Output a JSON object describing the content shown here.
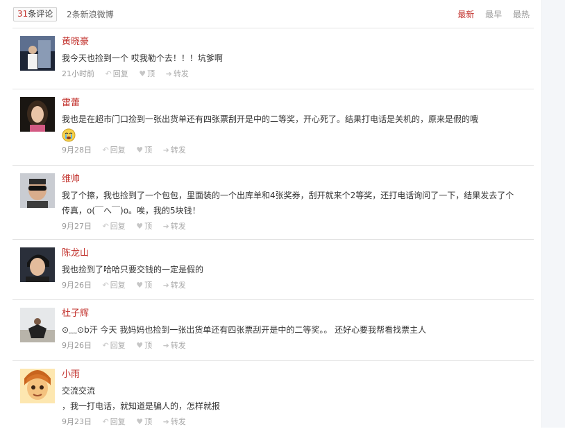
{
  "header": {
    "count_num": "31",
    "count_label": "条评论",
    "new_weibo": "2条新浪微博",
    "sort": [
      "最新",
      "最早",
      "最热"
    ]
  },
  "comments": [
    {
      "user": "黄晓豪",
      "text": "我今天也捡到一个 哎我勒个去！！！坑爹啊",
      "time": "21小时前"
    },
    {
      "user": "雷蕾",
      "text": "我也是在超市门口捡到一张出货单还有四张票刮开是中的二等奖，开心死了。结果打电话是关机的，原来是假的哦",
      "time": "9月28日"
    },
    {
      "user": "维帅",
      "text": "我了个擦，我也捡到了一个包包，里面装的一个出库单和4张奖券，刮开就来个2等奖，还打电话询问了一下，结果发去了个传真，o(￣へ￣)o。唉，我的5块钱！",
      "time": "9月27日"
    },
    {
      "user": "陈龙山",
      "text": "我也捡到了哈哈只要交钱的一定是假的",
      "time": "9月26日"
    },
    {
      "user": "杜子辉",
      "text": "⊙﹏⊙b汗 今天 我妈妈也捡到一张出货单还有四张票刮开是中的二等奖。。 还好心要我帮看找票主人",
      "time": "9月26日"
    },
    {
      "user": "小雨",
      "text": "交流交流",
      "text2": "，我一打电话，就知道是骗人的，怎样就报",
      "time": "9月23日"
    }
  ],
  "actions": {
    "reply": "回复",
    "up": "顶",
    "forward": "转发"
  },
  "colors": {
    "accent": "#c2312c",
    "divider": "#e3e3e3",
    "muted": "#999999"
  }
}
